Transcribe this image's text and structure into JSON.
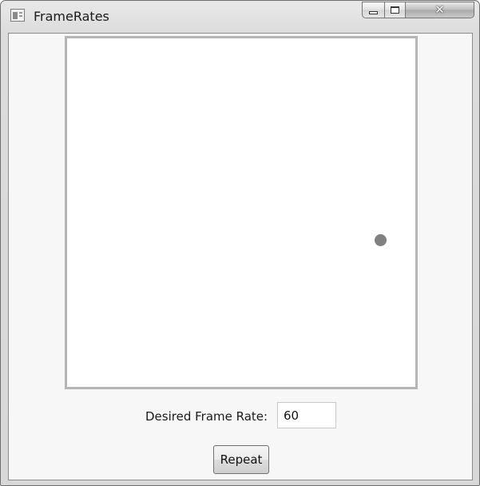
{
  "window": {
    "title": "FrameRates",
    "icons": {
      "app": "app-window-icon",
      "minimize": "minimize-icon",
      "maximize": "maximize-icon",
      "close": "close-icon"
    }
  },
  "canvas": {
    "ball_color": "#808080",
    "border_color": "#b5b5b5"
  },
  "controls": {
    "frame_rate_label": "Desired Frame Rate:",
    "frame_rate_value": "60",
    "repeat_label": "Repeat"
  }
}
